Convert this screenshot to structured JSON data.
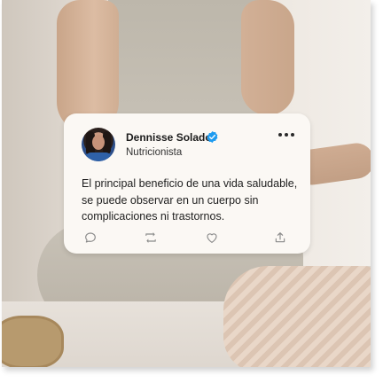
{
  "post": {
    "author_name": "Dennisse Solado",
    "author_role": "Nutricionista",
    "verified": true,
    "text": "El principal beneficio de una vida saludable, se puede observar en un cuerpo sin complicaciones ni trastornos.",
    "more_icon": "more-horizontal-icon"
  },
  "actions": [
    {
      "name": "reply",
      "icon": "comment-icon"
    },
    {
      "name": "repost",
      "icon": "repost-icon"
    },
    {
      "name": "like",
      "icon": "heart-icon"
    },
    {
      "name": "share",
      "icon": "share-icon"
    }
  ],
  "colors": {
    "card_bg": "#fbf8f4",
    "verified_blue": "#1d9bf0",
    "icon_gray": "#8a8a8a"
  }
}
